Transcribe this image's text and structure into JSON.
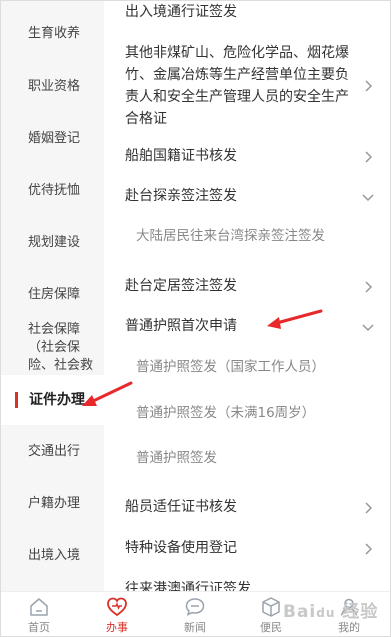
{
  "sidebar": {
    "items": [
      {
        "label": "生育收养"
      },
      {
        "label": "职业资格"
      },
      {
        "label": "婚姻登记"
      },
      {
        "label": "优待抚恤"
      },
      {
        "label": "规划建设"
      },
      {
        "label": "住房保障"
      },
      {
        "label": "社会保障（社会保险、社会救助）"
      },
      {
        "label": "证件办理"
      },
      {
        "label": "交通出行"
      },
      {
        "label": "户籍办理"
      },
      {
        "label": "出境入境"
      }
    ],
    "active_index": 7
  },
  "content": {
    "rows": [
      {
        "label": "出入境通行证签发"
      },
      {
        "label": "其他非煤矿山、危险化学品、烟花爆竹、金属冶炼等生产经营单位主要负责人和安全生产管理人员的安全生产合格证"
      },
      {
        "label": "船舶国籍证书核发"
      },
      {
        "label": "赴台探亲签注签发"
      },
      {
        "label": "大陆居民往来台湾探亲签注签发"
      },
      {
        "label": "赴台定居签注签发"
      },
      {
        "label": "普通护照首次申请"
      },
      {
        "label": "普通护照签发（国家工作人员）"
      },
      {
        "label": "普通护照签发（未满16周岁）"
      },
      {
        "label": "普通护照签发"
      },
      {
        "label": "船员适任证书核发"
      },
      {
        "label": "特种设备使用登记"
      },
      {
        "label": "往来港澳通行证签发"
      }
    ]
  },
  "tabbar": {
    "tabs": [
      {
        "label": "首页",
        "icon": "home-icon"
      },
      {
        "label": "办事",
        "icon": "heart-icon"
      },
      {
        "label": "新闻",
        "icon": "chat-icon"
      },
      {
        "label": "便民",
        "icon": "cube-icon"
      },
      {
        "label": "我的",
        "icon": "user-icon"
      }
    ],
    "active_index": 1
  },
  "watermark": {
    "text": "Bai du 经验"
  },
  "colors": {
    "accent": "#d9322a",
    "sidebar_bg": "#f6f6f7",
    "annotation_arrow": "#e8282b"
  }
}
